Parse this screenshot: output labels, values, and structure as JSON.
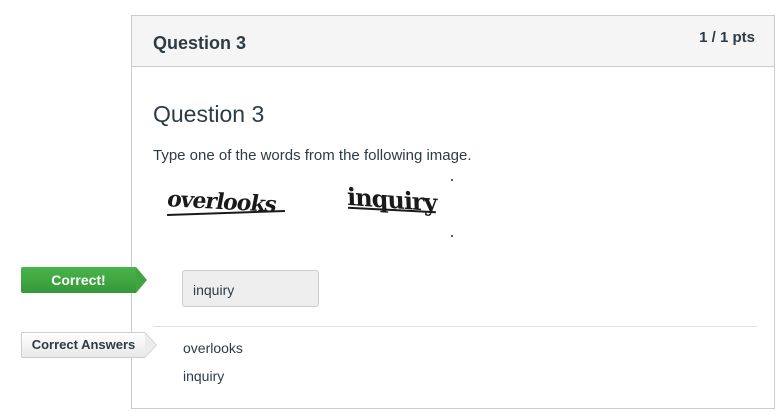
{
  "header": {
    "title": "Question 3",
    "points": "1 / 1 pts"
  },
  "question": {
    "heading": "Question 3",
    "text": "Type one of the words from the following image.",
    "captcha_words": [
      "overlooks",
      "inquiry"
    ]
  },
  "response": {
    "status_label": "Correct!",
    "answer_value": "inquiry"
  },
  "correct_answers": {
    "label": "Correct Answers",
    "items": [
      "overlooks",
      "inquiry"
    ]
  },
  "colors": {
    "correct_tag": "#3fa441",
    "header_bg": "#f5f5f5",
    "border": "#c7cdd1",
    "text": "#2d3b45"
  }
}
